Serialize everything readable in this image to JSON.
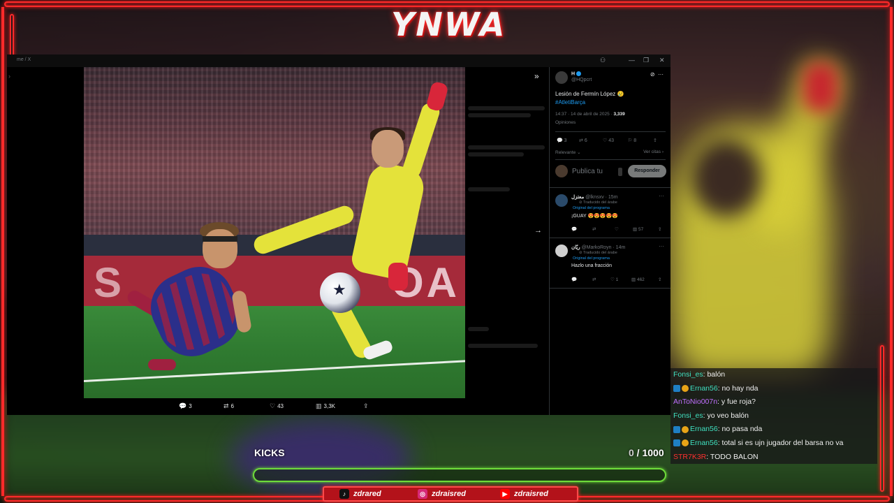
{
  "overlay": {
    "logo": "YNWA",
    "kicks": {
      "label": "KICKS",
      "current": "0",
      "separator": " / ",
      "goal": "1000",
      "progress": 0
    },
    "socials": [
      {
        "icon": "tiktok-icon",
        "glyph": "♪",
        "handle": "zdrared",
        "color": "#111111"
      },
      {
        "icon": "instagram-icon",
        "glyph": "◎",
        "handle": "zdraisred",
        "color": "#d62976"
      },
      {
        "icon": "youtube-icon",
        "glyph": "▶",
        "handle": "zdraisred",
        "color": "#ff0000"
      }
    ],
    "chat": [
      {
        "user": "Fonsi_es",
        "color": "#40e0c0",
        "badges": [],
        "message": ": balón"
      },
      {
        "user": "Ernan56",
        "color": "#40e0c0",
        "badges": [
          "mod",
          "sub"
        ],
        "message": ": no hay nda"
      },
      {
        "user": "AnToNio007n",
        "color": "#c070ff",
        "badges": [],
        "message": ": y fue roja?"
      },
      {
        "user": "Fonsi_es",
        "color": "#40e0c0",
        "badges": [],
        "message": ": yo veo balón"
      },
      {
        "user": "Ernan56",
        "color": "#40e0c0",
        "badges": [
          "mod",
          "sub"
        ],
        "message": ": no pasa nda"
      },
      {
        "user": "Ernan56",
        "color": "#40e0c0",
        "badges": [
          "mod",
          "sub"
        ],
        "message": ": total si es ujn jugador del barsa no va"
      },
      {
        "user": "STR7K3R",
        "color": "#ff3030",
        "badges": [],
        "message": ": TODO BALON"
      }
    ]
  },
  "browser": {
    "breadcrumb": "me / X",
    "window_controls": [
      "⚇",
      "—",
      "❐",
      "✕"
    ],
    "photo_actions": {
      "replies": "3",
      "reposts": "6",
      "likes": "43",
      "views": "3,3K"
    }
  },
  "tweet": {
    "name": "H",
    "handle": "@HQpcrt",
    "text": "Lesión de Fermín López 😢",
    "hashtag": "#AtletiBarça",
    "time": "14:37 · 14 de abril de 2025 · ",
    "views": "3,339",
    "views_label": "Opiniones",
    "stats": {
      "replies": "3",
      "reposts": "6",
      "likes": "43",
      "bookmarks": "8"
    },
    "sort_label": "Relevante",
    "more_label": "Ver citas",
    "reply_placeholder": "Publica tu",
    "reply_button": "Responder"
  },
  "comments": [
    {
      "name": "معتزل",
      "meta": "@lknsxv · 15m",
      "translation": "Traducido del árabe",
      "original": "Original del programa",
      "text": "¡GUAY 😍😍😍😍😍",
      "actions": {
        "views": "57"
      },
      "avatar_color": "#2a4a6a"
    },
    {
      "name": "ريّان",
      "meta": "@MarkoRoyn · 14m",
      "translation": "Traducido del árabe",
      "original": "Original del programa",
      "text": "Hazlo una fracción",
      "actions": {
        "likes": "1",
        "views": "462"
      },
      "avatar_color": "#cfcfcf"
    }
  ]
}
